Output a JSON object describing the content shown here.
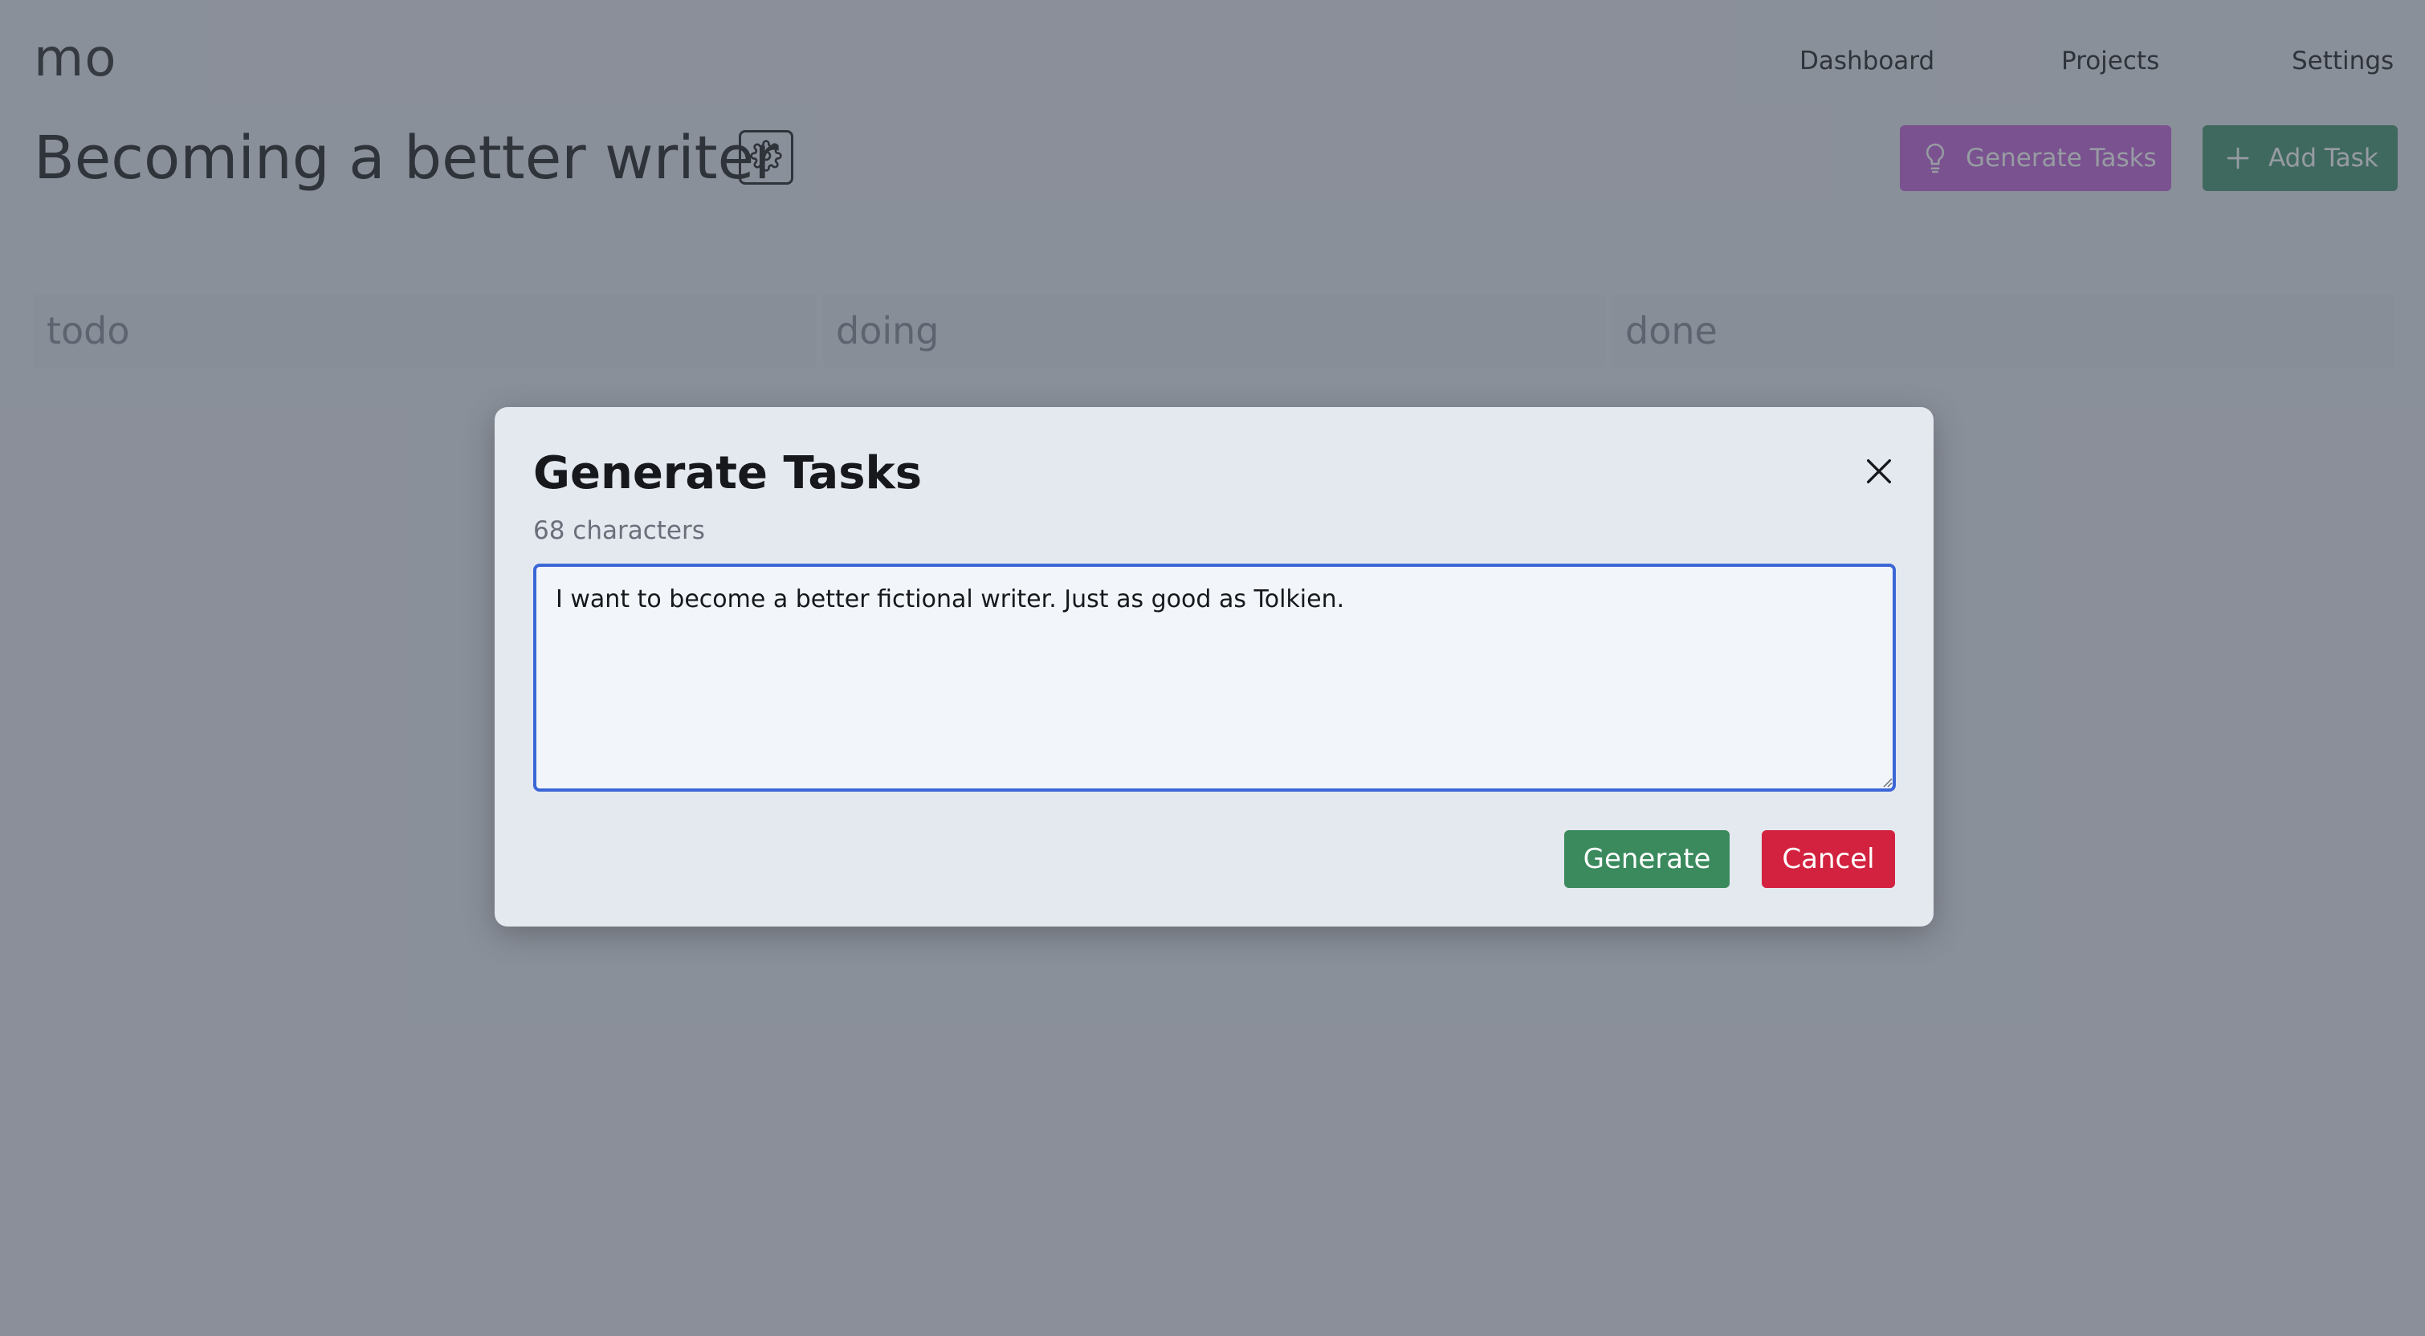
{
  "app": {
    "brand": "mo"
  },
  "nav": {
    "dashboard": "Dashboard",
    "projects": "Projects",
    "settings": "Settings"
  },
  "page": {
    "title": "Becoming a better writer",
    "generate_tasks_label": "Generate Tasks",
    "add_task_label": "Add Task"
  },
  "columns": [
    {
      "label": "todo"
    },
    {
      "label": "doing"
    },
    {
      "label": "done"
    }
  ],
  "modal": {
    "title": "Generate Tasks",
    "char_count": "68 characters",
    "prompt_value": "I want to become a better fictional writer. Just as good as Tolkien.",
    "generate_label": "Generate",
    "cancel_label": "Cancel"
  },
  "colors": {
    "generate_tasks_button": "#c26dd9",
    "add_task_button": "#4f9a79",
    "generate_button": "#3a8a5d",
    "cancel_button": "#d3223f",
    "textarea_focus": "#3a66d6"
  },
  "icons": {
    "settings": "gear-icon",
    "generate_tasks": "lightbulb-icon",
    "add_task": "plus-icon",
    "close": "close-icon"
  }
}
